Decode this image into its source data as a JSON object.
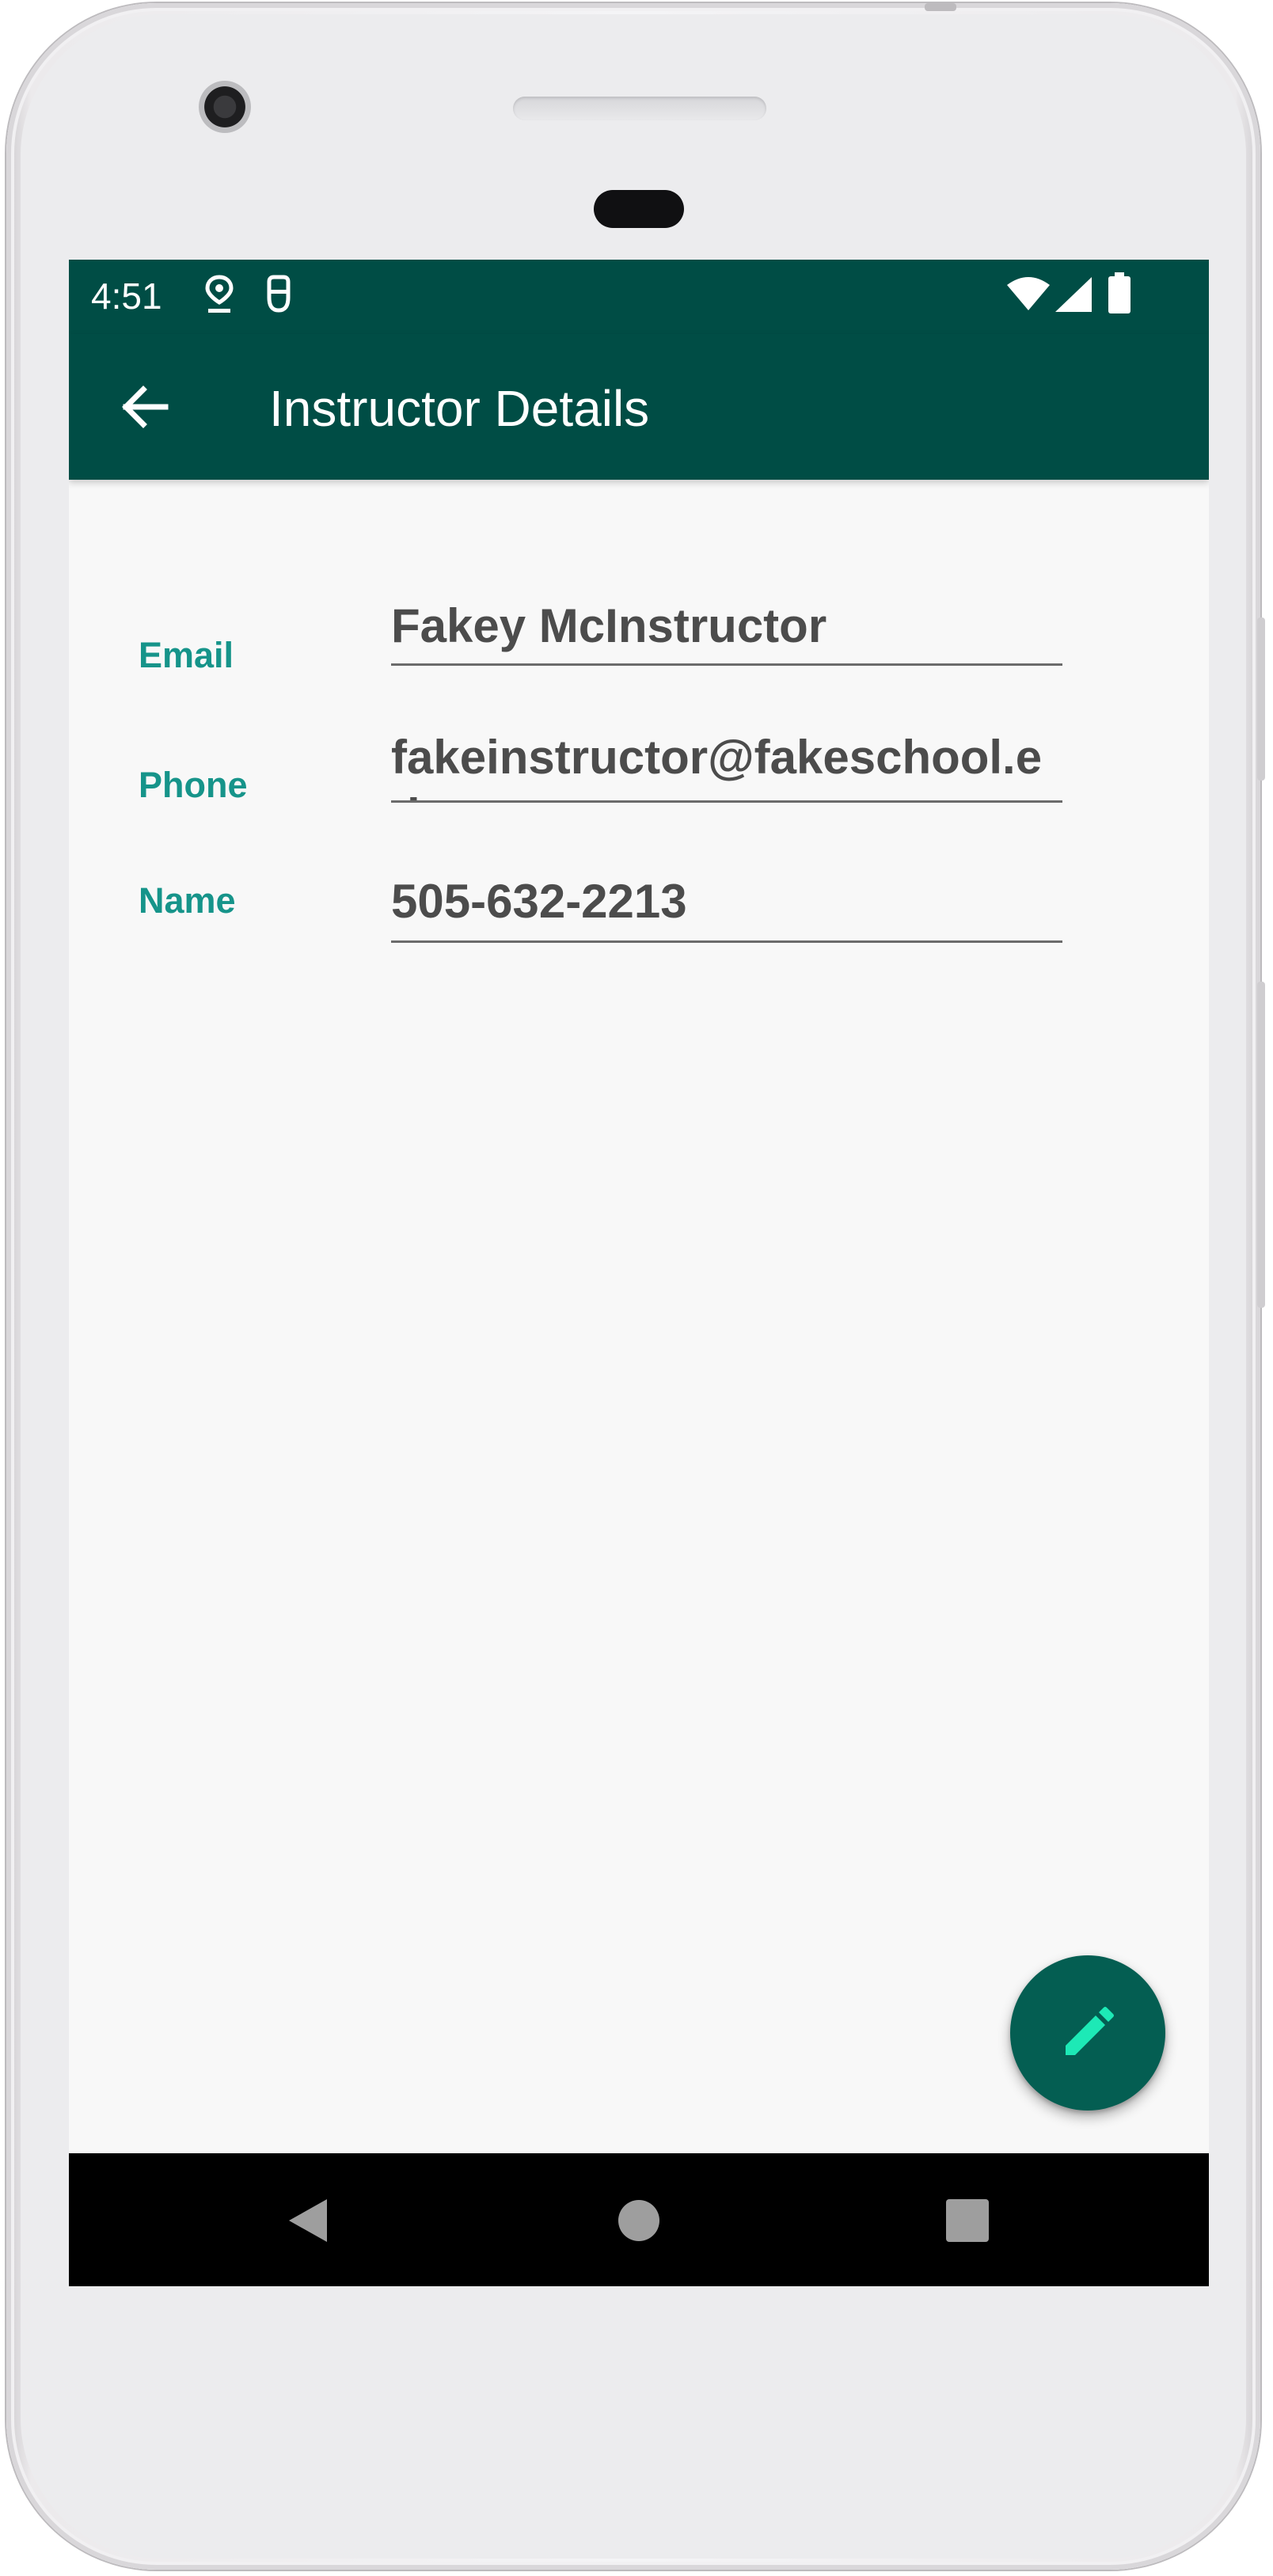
{
  "status_bar": {
    "time": "4:51",
    "icons": [
      "location-pin-icon",
      "sim-card-icon",
      "wifi-icon",
      "signal-icon",
      "battery-icon"
    ]
  },
  "app_bar": {
    "title": "Instructor Details",
    "back_icon": "arrow-back-icon"
  },
  "fields": [
    {
      "label": "Name",
      "value": "Fakey McInstructor"
    },
    {
      "label": "Email",
      "value": "fakeinstructor@fakeschool.edu"
    },
    {
      "label": "Phone",
      "value": "505-632-2213"
    }
  ],
  "fab": {
    "icon": "pencil-edit-icon"
  },
  "nav_bar": {
    "icons": [
      "nav-back-icon",
      "nav-home-icon",
      "nav-recents-icon"
    ]
  },
  "colors": {
    "primary_dark": "#004d45",
    "accent": "#16948a",
    "fab": "#045e52",
    "fab_icon": "#1de9b6"
  }
}
